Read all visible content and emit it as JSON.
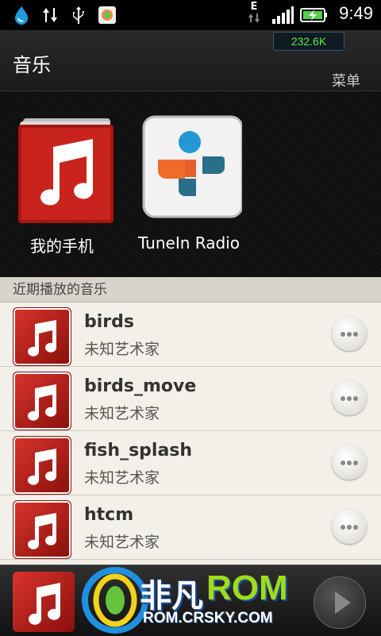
{
  "status_bar": {
    "time": "9:49",
    "network": "E",
    "icons": [
      "weather-drop-icon",
      "data-transfer-icon",
      "usb-icon",
      "app-icon",
      "signal-icon",
      "battery-charging-icon"
    ]
  },
  "header": {
    "title": "音乐",
    "speed": "232.6K",
    "menu_label": "菜单"
  },
  "apps": [
    {
      "label": "我的手机",
      "icon": "music-note-icon"
    },
    {
      "label": "TuneIn Radio",
      "icon": "tunein-icon"
    }
  ],
  "section": {
    "recent_label": "近期播放的音乐"
  },
  "tracks": [
    {
      "title": "birds",
      "artist": "未知艺术家"
    },
    {
      "title": "birds_move",
      "artist": "未知艺术家"
    },
    {
      "title": "fish_splash",
      "artist": "未知艺术家"
    },
    {
      "title": "htcm",
      "artist": "未知艺术家"
    }
  ],
  "now_playing": {
    "play_icon": "play-icon"
  },
  "watermark": {
    "brand_cn": "非凡",
    "brand_en": "ROM",
    "url": "ROM.CRSKY.COM"
  },
  "colors": {
    "accent_green": "#4ff04a",
    "album_red": "#c8231d",
    "list_bg": "#f1eee8"
  }
}
